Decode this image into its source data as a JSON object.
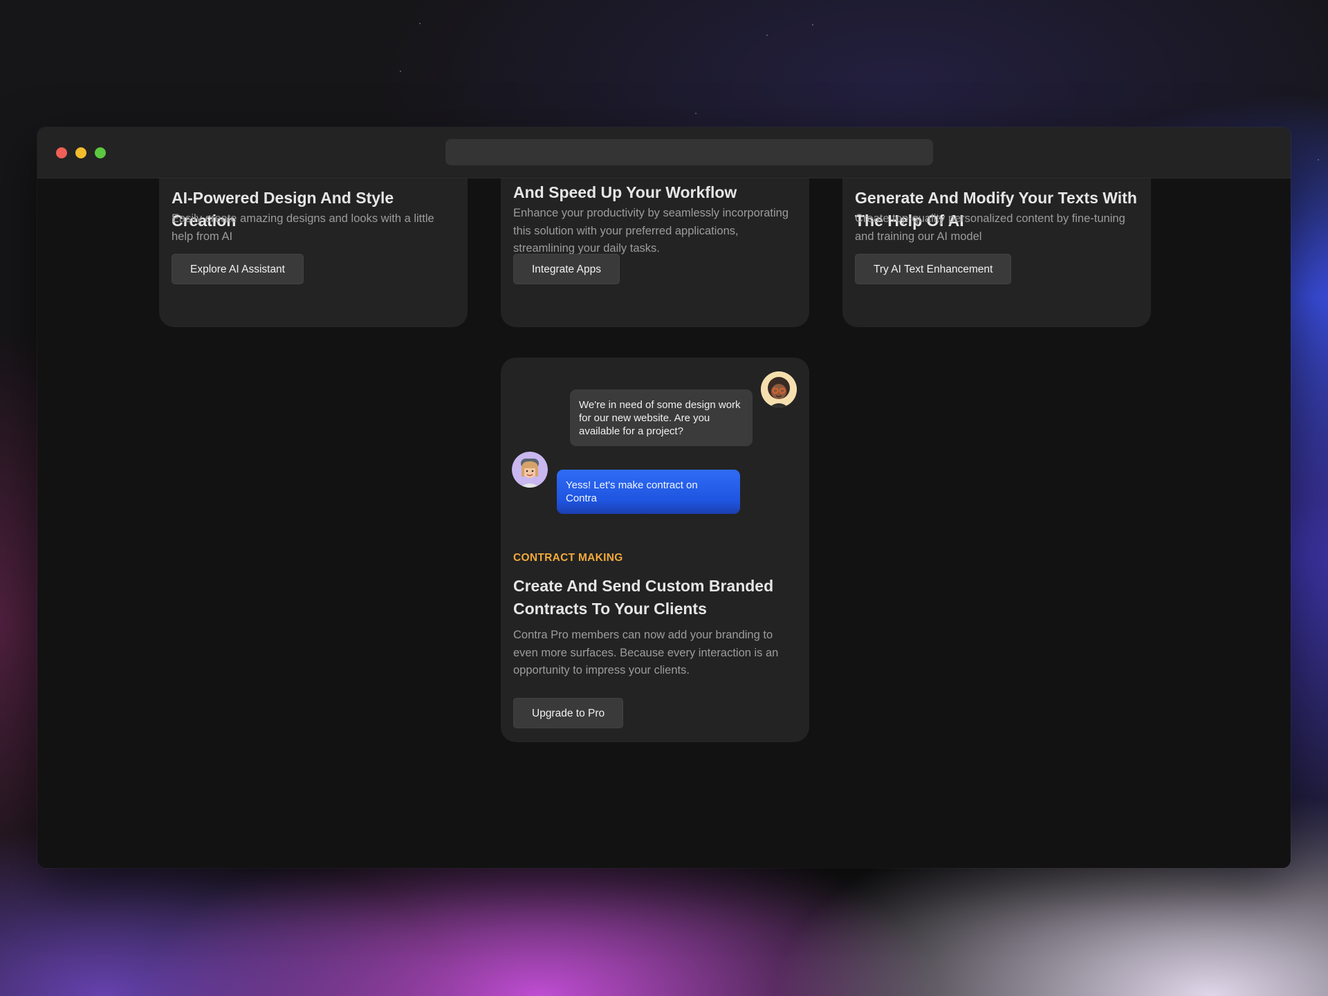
{
  "cards": {
    "design": {
      "title": "AI-Powered Design And Style Creation",
      "description": "Easily create amazing designs and looks with a little help from AI",
      "button": "Explore AI Assistant"
    },
    "integrate": {
      "title_partial": "And Speed Up Your Workflow",
      "description": "Enhance your productivity by seamlessly incorporating this solution with your preferred applications, streamlining your daily tasks.",
      "button": "Integrate Apps"
    },
    "text": {
      "title": "Generate And Modify Your Texts With The Help Of AI",
      "description": "Create top-quality personalized content by fine-tuning and training our AI model",
      "button": "Try AI Text Enhancement"
    },
    "contract": {
      "chat": {
        "incoming": "We're in need of some design work for our new website. Are you available for a project?",
        "reply": "Yess! Let's make contract on Contra"
      },
      "eyebrow": "CONTRACT MAKING",
      "title": "Create And Send Custom Branded Contracts To Your Clients",
      "description": "Contra Pro members can now add your branding to even more surfaces. Because every interaction is an opportunity to impress your clients.",
      "button": "Upgrade to Pro"
    }
  },
  "colors": {
    "accent_orange": "#f2a93b",
    "accent_blue": "#2f6cf5",
    "card_bg": "#232323",
    "page_bg": "#121212"
  },
  "icons": {
    "window_controls": [
      "close-dot",
      "minimize-dot",
      "maximize-dot"
    ],
    "avatars": [
      "avatar-client-memoji",
      "avatar-freelancer-memoji"
    ]
  }
}
